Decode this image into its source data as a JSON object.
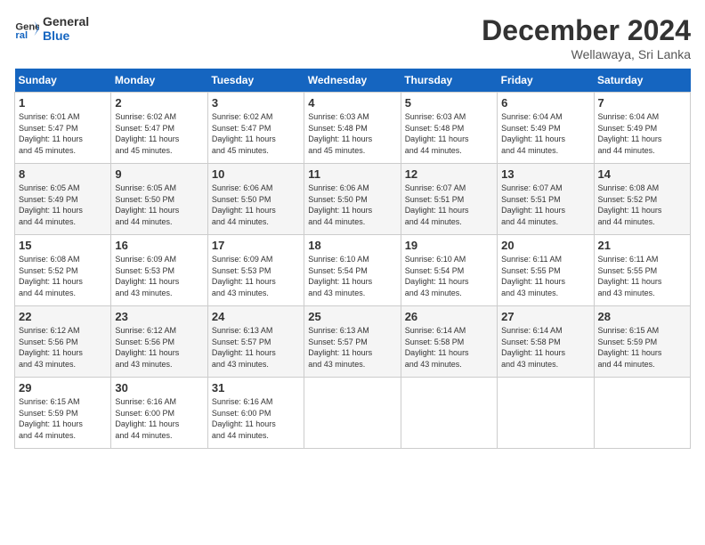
{
  "header": {
    "logo_line1": "General",
    "logo_line2": "Blue",
    "month": "December 2024",
    "location": "Wellawaya, Sri Lanka"
  },
  "weekdays": [
    "Sunday",
    "Monday",
    "Tuesday",
    "Wednesday",
    "Thursday",
    "Friday",
    "Saturday"
  ],
  "weeks": [
    [
      {
        "day": "1",
        "info": "Sunrise: 6:01 AM\nSunset: 5:47 PM\nDaylight: 11 hours\nand 45 minutes."
      },
      {
        "day": "2",
        "info": "Sunrise: 6:02 AM\nSunset: 5:47 PM\nDaylight: 11 hours\nand 45 minutes."
      },
      {
        "day": "3",
        "info": "Sunrise: 6:02 AM\nSunset: 5:47 PM\nDaylight: 11 hours\nand 45 minutes."
      },
      {
        "day": "4",
        "info": "Sunrise: 6:03 AM\nSunset: 5:48 PM\nDaylight: 11 hours\nand 45 minutes."
      },
      {
        "day": "5",
        "info": "Sunrise: 6:03 AM\nSunset: 5:48 PM\nDaylight: 11 hours\nand 44 minutes."
      },
      {
        "day": "6",
        "info": "Sunrise: 6:04 AM\nSunset: 5:49 PM\nDaylight: 11 hours\nand 44 minutes."
      },
      {
        "day": "7",
        "info": "Sunrise: 6:04 AM\nSunset: 5:49 PM\nDaylight: 11 hours\nand 44 minutes."
      }
    ],
    [
      {
        "day": "8",
        "info": "Sunrise: 6:05 AM\nSunset: 5:49 PM\nDaylight: 11 hours\nand 44 minutes."
      },
      {
        "day": "9",
        "info": "Sunrise: 6:05 AM\nSunset: 5:50 PM\nDaylight: 11 hours\nand 44 minutes."
      },
      {
        "day": "10",
        "info": "Sunrise: 6:06 AM\nSunset: 5:50 PM\nDaylight: 11 hours\nand 44 minutes."
      },
      {
        "day": "11",
        "info": "Sunrise: 6:06 AM\nSunset: 5:50 PM\nDaylight: 11 hours\nand 44 minutes."
      },
      {
        "day": "12",
        "info": "Sunrise: 6:07 AM\nSunset: 5:51 PM\nDaylight: 11 hours\nand 44 minutes."
      },
      {
        "day": "13",
        "info": "Sunrise: 6:07 AM\nSunset: 5:51 PM\nDaylight: 11 hours\nand 44 minutes."
      },
      {
        "day": "14",
        "info": "Sunrise: 6:08 AM\nSunset: 5:52 PM\nDaylight: 11 hours\nand 44 minutes."
      }
    ],
    [
      {
        "day": "15",
        "info": "Sunrise: 6:08 AM\nSunset: 5:52 PM\nDaylight: 11 hours\nand 44 minutes."
      },
      {
        "day": "16",
        "info": "Sunrise: 6:09 AM\nSunset: 5:53 PM\nDaylight: 11 hours\nand 43 minutes."
      },
      {
        "day": "17",
        "info": "Sunrise: 6:09 AM\nSunset: 5:53 PM\nDaylight: 11 hours\nand 43 minutes."
      },
      {
        "day": "18",
        "info": "Sunrise: 6:10 AM\nSunset: 5:54 PM\nDaylight: 11 hours\nand 43 minutes."
      },
      {
        "day": "19",
        "info": "Sunrise: 6:10 AM\nSunset: 5:54 PM\nDaylight: 11 hours\nand 43 minutes."
      },
      {
        "day": "20",
        "info": "Sunrise: 6:11 AM\nSunset: 5:55 PM\nDaylight: 11 hours\nand 43 minutes."
      },
      {
        "day": "21",
        "info": "Sunrise: 6:11 AM\nSunset: 5:55 PM\nDaylight: 11 hours\nand 43 minutes."
      }
    ],
    [
      {
        "day": "22",
        "info": "Sunrise: 6:12 AM\nSunset: 5:56 PM\nDaylight: 11 hours\nand 43 minutes."
      },
      {
        "day": "23",
        "info": "Sunrise: 6:12 AM\nSunset: 5:56 PM\nDaylight: 11 hours\nand 43 minutes."
      },
      {
        "day": "24",
        "info": "Sunrise: 6:13 AM\nSunset: 5:57 PM\nDaylight: 11 hours\nand 43 minutes."
      },
      {
        "day": "25",
        "info": "Sunrise: 6:13 AM\nSunset: 5:57 PM\nDaylight: 11 hours\nand 43 minutes."
      },
      {
        "day": "26",
        "info": "Sunrise: 6:14 AM\nSunset: 5:58 PM\nDaylight: 11 hours\nand 43 minutes."
      },
      {
        "day": "27",
        "info": "Sunrise: 6:14 AM\nSunset: 5:58 PM\nDaylight: 11 hours\nand 43 minutes."
      },
      {
        "day": "28",
        "info": "Sunrise: 6:15 AM\nSunset: 5:59 PM\nDaylight: 11 hours\nand 44 minutes."
      }
    ],
    [
      {
        "day": "29",
        "info": "Sunrise: 6:15 AM\nSunset: 5:59 PM\nDaylight: 11 hours\nand 44 minutes."
      },
      {
        "day": "30",
        "info": "Sunrise: 6:16 AM\nSunset: 6:00 PM\nDaylight: 11 hours\nand 44 minutes."
      },
      {
        "day": "31",
        "info": "Sunrise: 6:16 AM\nSunset: 6:00 PM\nDaylight: 11 hours\nand 44 minutes."
      },
      null,
      null,
      null,
      null
    ]
  ]
}
